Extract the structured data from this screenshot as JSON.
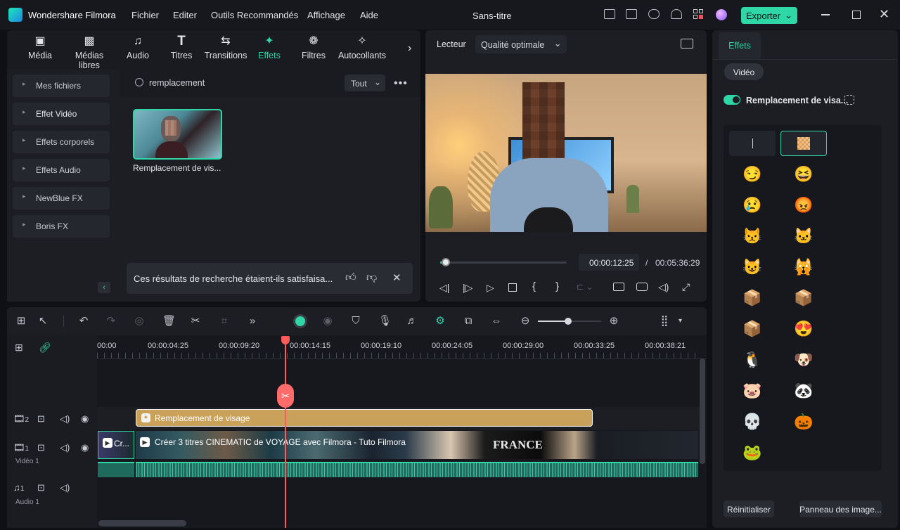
{
  "app": {
    "name": "Wondershare Filmora",
    "doc_title": "Sans-titre",
    "export_label": "Exporter"
  },
  "menu": [
    "Fichier",
    "Editer",
    "Outils Recommandés",
    "Affichage",
    "Aide"
  ],
  "toolbar": [
    {
      "label": "Média",
      "icon": "media-icon"
    },
    {
      "label": "Médias libres",
      "icon": "stock-media-icon"
    },
    {
      "label": "Audio",
      "icon": "music-note-icon"
    },
    {
      "label": "Titres",
      "icon": "title-T-icon"
    },
    {
      "label": "Transitions",
      "icon": "transitions-icon"
    },
    {
      "label": "Effets",
      "icon": "effects-star-icon"
    },
    {
      "label": "Filtres",
      "icon": "filters-icon"
    },
    {
      "label": "Autocollants",
      "icon": "stickers-icon"
    }
  ],
  "sidebar": [
    "Mes fichiers",
    "Effet Vidéo",
    "Effets corporels",
    "Effets Audio",
    "NewBlue FX",
    "Boris FX"
  ],
  "search": {
    "value": "remplacement",
    "filter": "Tout"
  },
  "result": {
    "label": "Remplacement de vis..."
  },
  "feedback": {
    "question": "Ces résultats de recherche étaient-ils satisfaisa..."
  },
  "player": {
    "tab": "Lecteur",
    "quality": "Qualité optimale",
    "current_time": "00:00:12:25",
    "separator": "/",
    "total_time": "00:05:36:29",
    "progress": 0.04
  },
  "right_panel": {
    "tab": "Effets",
    "subtab": "Vidéo",
    "effect_name": "Remplacement de visa...",
    "reset_label": "Réinitialiser",
    "panel_label": "Panneau des image..."
  },
  "ruler": [
    "00:00",
    "00:00:04:25",
    "00:00:09:20",
    "00:00:14:15",
    "00:00:19:10",
    "00:00:24:05",
    "00:00:29:00",
    "00:00:33:25",
    "00:00:38:21"
  ],
  "tracks": {
    "effect_clip": "Remplacement de visage",
    "video_clip": "Créer 3 titres CINEMATIC de VOYAGE avec Filmora - Tuto Filmora",
    "video_clip_short": "Cr...",
    "video_label": "Vidéo 1",
    "audio_label": "Audio 1",
    "track2_num": "2",
    "track1_num": "1",
    "audio_num": "1",
    "thumb_text": "FRANCE"
  },
  "emoji_grid": [
    "cursor",
    "pixel",
    "smirk",
    "laugh",
    "sad",
    "angry",
    "cat-devil",
    "cat-white",
    "cat-2",
    "cat-3",
    "box-face",
    "box-face-2",
    "box-face-3",
    "box-heart",
    "penguin",
    "dog",
    "pig",
    "panda",
    "skull",
    "pumpkin",
    "frog"
  ]
}
